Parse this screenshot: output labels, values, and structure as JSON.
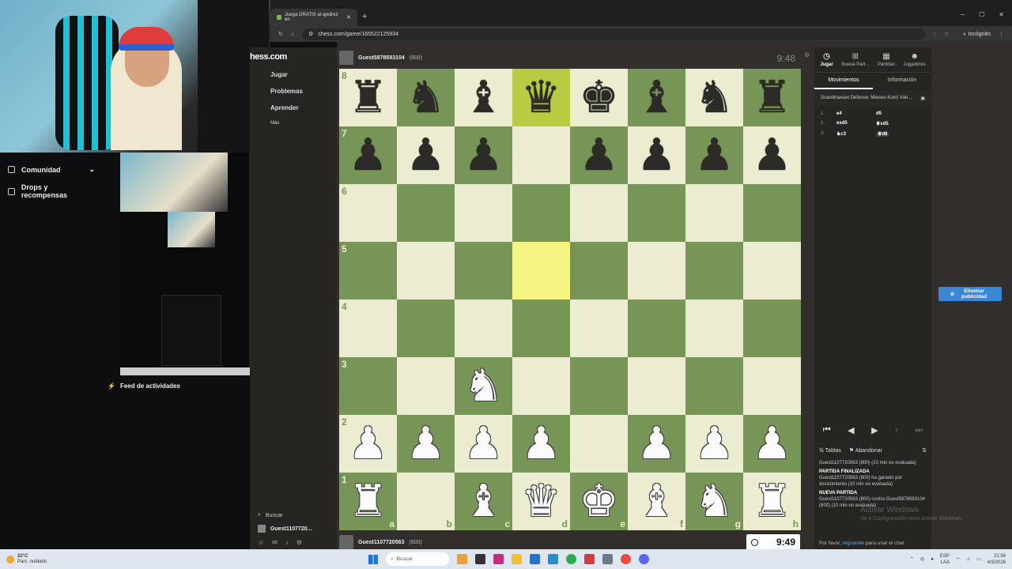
{
  "twitch": {
    "community": "Comunidad",
    "drops": "Drops y recompensas",
    "feed": "Feed de actividades"
  },
  "browser": {
    "tab_title": "Juega GRATIS al ajedrez en",
    "url": "chess.com/game/165522125934",
    "incognito": "Incógnito"
  },
  "chess_nav": {
    "brand": "hess.com",
    "items": [
      "Jugar",
      "Problemas",
      "Aprender",
      "Más"
    ],
    "search": "Buscar",
    "user": "Guest1107720..."
  },
  "players": {
    "top": {
      "name": "Guest5878593104",
      "rating": "(800)",
      "clock": "9:48"
    },
    "bottom": {
      "name": "Guest1107720563",
      "rating": "(800)",
      "clock": "9:49"
    }
  },
  "board": {
    "ranks": [
      "8",
      "7",
      "6",
      "5",
      "4",
      "3",
      "2",
      "1"
    ],
    "files": [
      "a",
      "b",
      "c",
      "d",
      "e",
      "f",
      "g",
      "h"
    ],
    "rows": [
      [
        "br",
        "bn",
        "bb",
        "bq",
        "bk",
        "bb",
        "bn",
        "br"
      ],
      [
        "bp",
        "bp",
        "bp",
        "",
        "bp",
        "bp",
        "bp",
        "bp"
      ],
      [
        "",
        "",
        "",
        "",
        "",
        "",
        "",
        ""
      ],
      [
        "",
        "",
        "",
        "",
        "",
        "",
        "",
        ""
      ],
      [
        "",
        "",
        "",
        "",
        "",
        "",
        "",
        ""
      ],
      [
        "",
        "",
        "wn",
        "",
        "",
        "",
        "",
        ""
      ],
      [
        "wp",
        "wp",
        "wp",
        "wp",
        "",
        "wp",
        "wp",
        "wp"
      ],
      [
        "wr",
        "",
        "wb",
        "wq",
        "wk",
        "wb",
        "wn",
        "wr"
      ]
    ],
    "highlight": [
      "d8",
      "d5"
    ]
  },
  "right_panel": {
    "tabs": [
      "Jugar",
      "Nueva Part...",
      "Partidas",
      "Jugadores"
    ],
    "subtabs": [
      "Movimientos",
      "Información"
    ],
    "opening": "Scandinavian Defense: Mieses-Kotrč Vari...",
    "moves": [
      {
        "n": "1.",
        "w": "e4",
        "b": "d5"
      },
      {
        "n": "2.",
        "w": "exd5",
        "b": "♛xd5"
      },
      {
        "n": "3.",
        "w": "♞c3",
        "b": "♛d8"
      }
    ],
    "draw": "Tablas",
    "resign": "Abandonar",
    "chat": [
      {
        "t": "",
        "text": "Guest1107720563 (800) (10 min no evaluada)"
      },
      {
        "t": "PARTIDA FINALIZADA",
        "text": "Guest1107720563 (800) ha ganado por desistimiento (10 min no evaluada)"
      },
      {
        "t": "NUEVA PARTIDA",
        "text": "Guest1107720563 (800) contra Guest5878593104 (800) (10 min no evaluada)"
      }
    ],
    "chat_prompt_pre": "Por favor,",
    "chat_prompt_link": "regístrate",
    "chat_prompt_post": "para usar el chat."
  },
  "ad_button": "Eliminar publicidad",
  "watermark": {
    "line1": "Activar Windows",
    "line2": "Ve a Configuración para activar Windows."
  },
  "taskbar": {
    "temp": "22°C",
    "weather": "Parc. nublado",
    "search": "Buscar",
    "lang1": "ESP",
    "lang2": "LAA",
    "time": "21:56",
    "date": "4/3/2026"
  }
}
